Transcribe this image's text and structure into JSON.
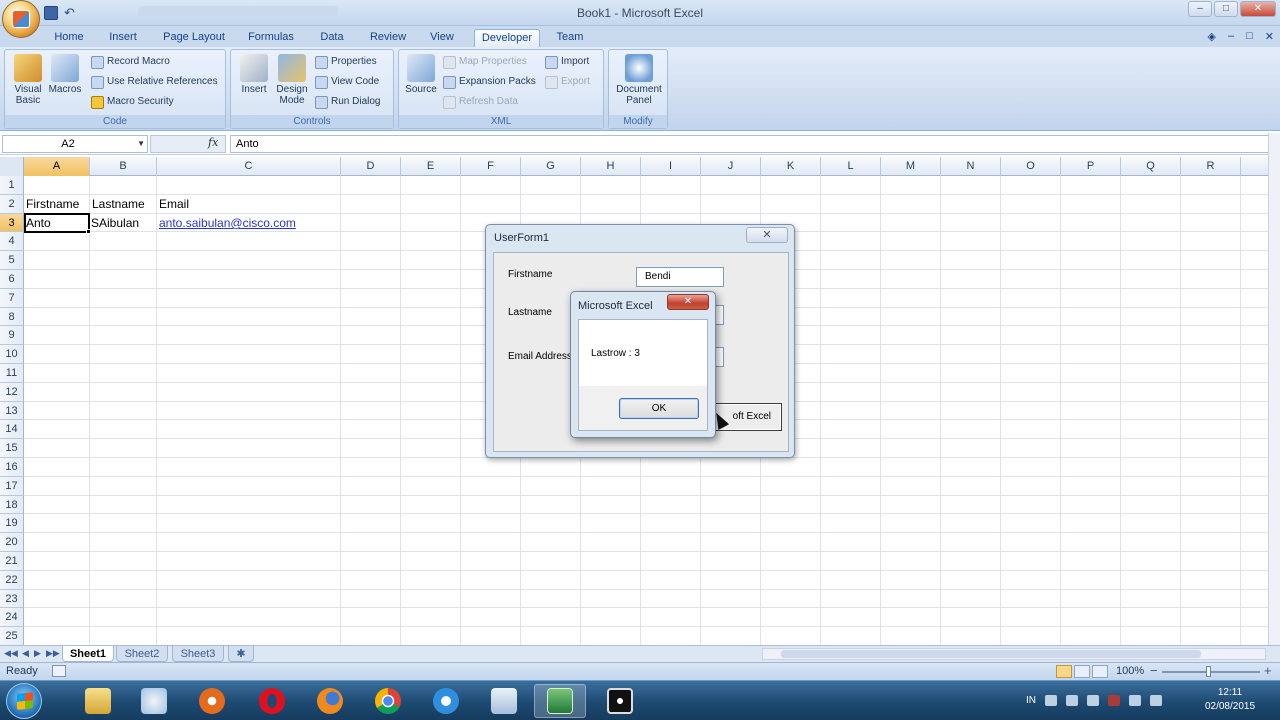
{
  "window": {
    "title": "Book1 - Microsoft Excel",
    "controls": [
      "–",
      "□",
      "✕"
    ]
  },
  "ribbon": {
    "tabs": [
      "Home",
      "Insert",
      "Page Layout",
      "Formulas",
      "Data",
      "Review",
      "View",
      "Developer",
      "Team"
    ],
    "active_tab": "Developer",
    "groups": {
      "code": {
        "label": "Code",
        "visual_basic": "Visual Basic",
        "macros": "Macros",
        "record_macro": "Record Macro",
        "use_relative": "Use Relative References",
        "macro_security": "Macro Security"
      },
      "controls": {
        "label": "Controls",
        "insert": "Insert",
        "design_mode": "Design Mode",
        "properties": "Properties",
        "view_code": "View Code",
        "run_dialog": "Run Dialog"
      },
      "xml": {
        "label": "XML",
        "source": "Source",
        "map_properties": "Map Properties",
        "expansion_packs": "Expansion Packs",
        "refresh_data": "Refresh Data",
        "import": "Import",
        "export": "Export"
      },
      "modify": {
        "label": "Modify",
        "document_panel": "Document Panel"
      }
    }
  },
  "formula_bar": {
    "name_box": "A2",
    "fx": "fx",
    "content": "Anto"
  },
  "grid": {
    "columns": [
      "A",
      "B",
      "C",
      "D",
      "E",
      "F",
      "G",
      "H",
      "I",
      "J",
      "K",
      "L",
      "M",
      "N",
      "O",
      "P",
      "Q",
      "R"
    ],
    "rows": [
      "1",
      "2",
      "3",
      "4",
      "5",
      "6",
      "7",
      "8",
      "9",
      "10",
      "11",
      "12",
      "13",
      "14",
      "15",
      "16",
      "17",
      "18",
      "19",
      "20",
      "21",
      "22",
      "23",
      "24",
      "25"
    ],
    "cells": {
      "A2": "Firstname",
      "B2": "Lastname",
      "C2": "Email",
      "A3": "Anto",
      "B3": "SAibulan",
      "C3": "anto.saibulan@cisco.com"
    }
  },
  "sheets": {
    "tabs": [
      "Sheet1",
      "Sheet2",
      "Sheet3"
    ],
    "active": "Sheet1"
  },
  "status": {
    "ready": "Ready",
    "zoom": "100%"
  },
  "userform": {
    "title": "UserForm1",
    "close": "✕",
    "firstname_label": "Firstname",
    "firstname_value": "Bendi",
    "lastname_label": "Lastname",
    "email_label": "Email Address",
    "submit_label": "oft Excel"
  },
  "msgbox": {
    "title": "Microsoft Excel",
    "close": "✕",
    "message": "Lastrow : 3",
    "ok": "OK"
  },
  "taskbar": {
    "apps": [
      "explorer",
      "paint",
      "media-player",
      "opera",
      "firefox",
      "chrome",
      "internet-explorer",
      "files",
      "excel",
      "camera"
    ],
    "tray_lang": "IN",
    "time": "12:11",
    "date": "02/08/2015"
  },
  "colors": {
    "accent": "#15428b",
    "ribbon": "#dbe7f5",
    "selection_header": "#f1c15f",
    "link": "#2b34cc",
    "taskbar": "#1d4a72"
  }
}
